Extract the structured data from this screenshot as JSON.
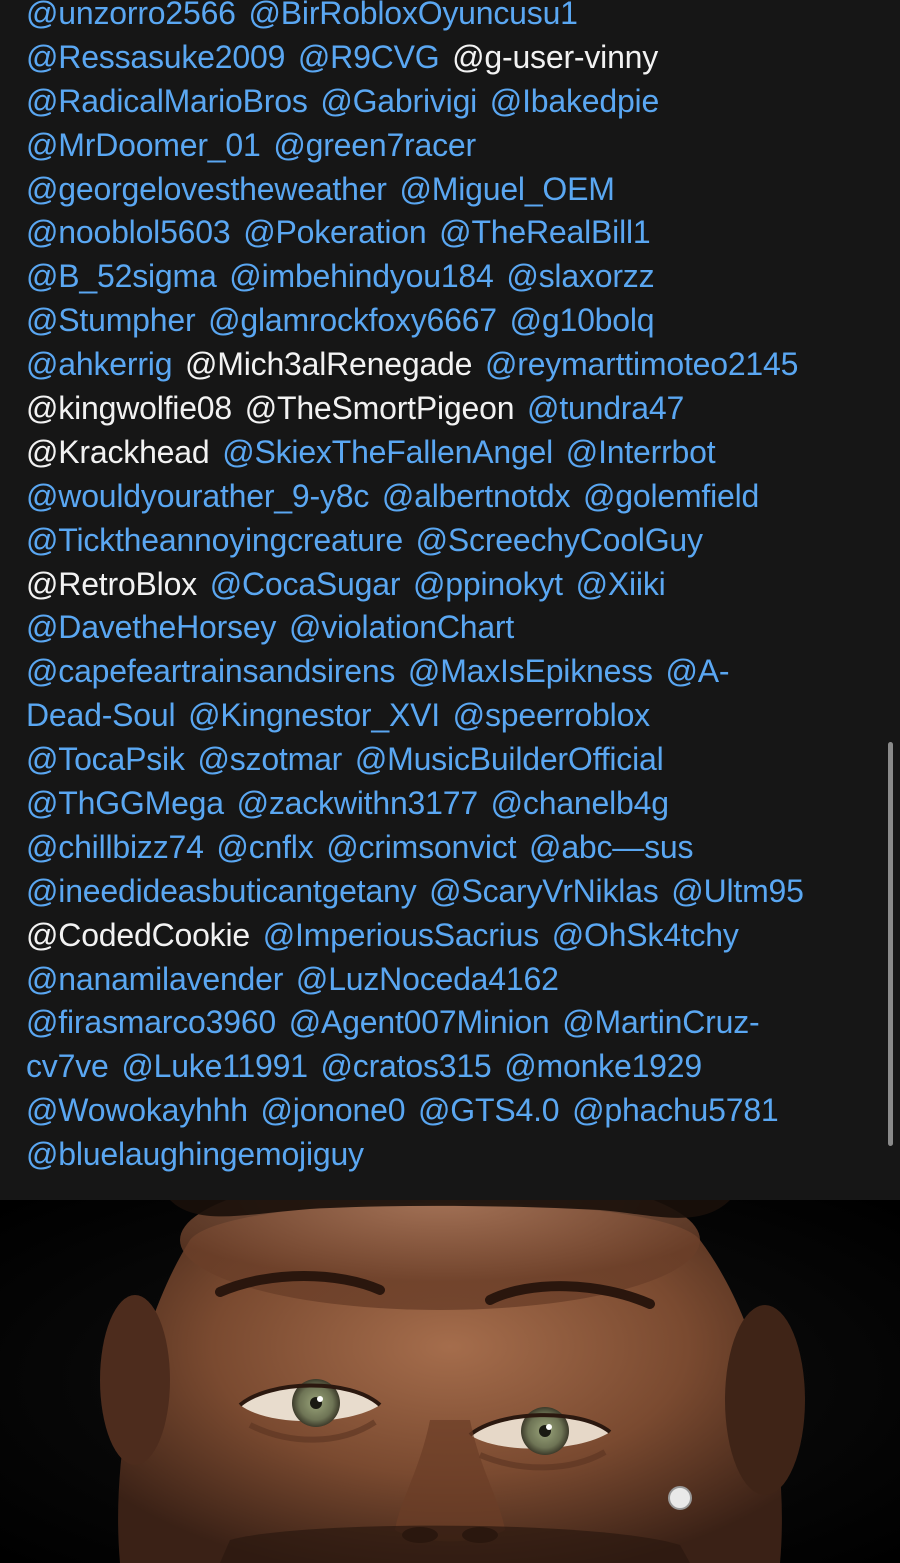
{
  "lines": [
    [
      {
        "t": "@unzorro2566",
        "m": true
      },
      {
        "t": "@BirRobloxOyuncusu1",
        "m": true
      }
    ],
    [
      {
        "t": "@Ressasuke2009",
        "m": true
      },
      {
        "t": "@R9CVG",
        "m": true
      },
      {
        "t": "@g-user-vinny",
        "m": false
      }
    ],
    [
      {
        "t": "@RadicalMarioBros",
        "m": true
      },
      {
        "t": "@Gabrivigi",
        "m": true
      },
      {
        "t": "@Ibakedpie",
        "m": true
      }
    ],
    [
      {
        "t": "@MrDoomer_01",
        "m": true
      },
      {
        "t": "@green7racer",
        "m": true
      }
    ],
    [
      {
        "t": "@georgelovestheweather",
        "m": true
      },
      {
        "t": "@Miguel_OEM",
        "m": true
      }
    ],
    [
      {
        "t": "@nooblol5603",
        "m": true
      },
      {
        "t": "@Pokeration",
        "m": true
      },
      {
        "t": "@TheRealBill1",
        "m": true
      }
    ],
    [
      {
        "t": "@B_52sigma",
        "m": true
      },
      {
        "t": "@imbehindyou184",
        "m": true
      },
      {
        "t": "@slaxorzz",
        "m": true
      }
    ],
    [
      {
        "t": "@Stumpher",
        "m": true
      },
      {
        "t": "@glamrockfoxy6667",
        "m": true
      },
      {
        "t": "@g10bolq",
        "m": true
      }
    ],
    [
      {
        "t": "@ahkerrig",
        "m": true
      },
      {
        "t": "@Mich3alRenegade",
        "m": false
      },
      {
        "t": "@reymarttimoteo2145",
        "m": true
      }
    ],
    [
      {
        "t": "@kingwolfie08",
        "m": false
      },
      {
        "t": "@TheSmortPigeon",
        "m": false
      },
      {
        "t": "@tundra47",
        "m": true
      }
    ],
    [
      {
        "t": "@Krackhead",
        "m": false
      },
      {
        "t": "@SkiexTheFallenAngel",
        "m": true
      },
      {
        "t": "@Interrbot",
        "m": true
      }
    ],
    [
      {
        "t": "@wouldyourather_9-y8c",
        "m": true
      },
      {
        "t": "@albertnotdx",
        "m": true
      },
      {
        "t": "@golemfield",
        "m": true
      }
    ],
    [
      {
        "t": "@Ticktheannoyingcreature",
        "m": true
      },
      {
        "t": "@ScreechyCoolGuy",
        "m": true
      }
    ],
    [
      {
        "t": "@RetroBlox",
        "m": false
      },
      {
        "t": "@CocaSugar",
        "m": true
      },
      {
        "t": "@ppinokyt",
        "m": true
      },
      {
        "t": "@Xiiki",
        "m": true
      }
    ],
    [
      {
        "t": "@DavetheHorsey",
        "m": true
      },
      {
        "t": "@violationChart",
        "m": true
      }
    ],
    [
      {
        "t": "@capefeartrainsandsirens",
        "m": true
      },
      {
        "t": "@MaxIsEpikness",
        "m": true
      },
      {
        "t": "@A-",
        "m": true
      }
    ],
    [
      {
        "t": "Dead-Soul",
        "m": true
      },
      {
        "t": "@Kingnestor_XVI",
        "m": true
      },
      {
        "t": "@speerroblox",
        "m": true
      }
    ],
    [
      {
        "t": "@TocaPsik",
        "m": true
      },
      {
        "t": "@szotmar",
        "m": true
      },
      {
        "t": "@MusicBuilderOfficial",
        "m": true
      }
    ],
    [
      {
        "t": "@ThGGMega",
        "m": true
      },
      {
        "t": "@zackwithn3177",
        "m": true
      },
      {
        "t": "@chanelb4g",
        "m": true
      }
    ],
    [
      {
        "t": "@chillbizz74",
        "m": true
      },
      {
        "t": "@cnflx",
        "m": true
      },
      {
        "t": "@crimsonvict",
        "m": true
      },
      {
        "t": "@abc—sus",
        "m": true
      }
    ],
    [
      {
        "t": "@ineedideasbuticantgetany",
        "m": true
      },
      {
        "t": "@ScaryVrNiklas",
        "m": true
      },
      {
        "t": "@Ultm95",
        "m": true
      }
    ],
    [
      {
        "t": "@CodedCookie",
        "m": false
      },
      {
        "t": "@ImperiousSacrius",
        "m": true
      },
      {
        "t": "@OhSk4tchy",
        "m": true
      }
    ],
    [
      {
        "t": "@nanamilavender",
        "m": true
      },
      {
        "t": "@LuzNoceda4162",
        "m": true
      }
    ],
    [
      {
        "t": "@firasmarco3960",
        "m": true
      },
      {
        "t": "@Agent007Minion",
        "m": true
      },
      {
        "t": "@MartinCruz-",
        "m": true
      }
    ],
    [
      {
        "t": "cv7ve",
        "m": true
      },
      {
        "t": "@Luke11991",
        "m": true
      },
      {
        "t": "@cratos315",
        "m": true
      },
      {
        "t": "@monke1929",
        "m": true
      }
    ],
    [
      {
        "t": "@Wowokayhhh",
        "m": true
      },
      {
        "t": "@jonone0",
        "m": true
      },
      {
        "t": "@GTS4.0",
        "m": true
      },
      {
        "t": "@phachu5781",
        "m": true
      }
    ],
    [
      {
        "t": "@bluelaughingemojiguy",
        "m": true
      }
    ]
  ],
  "colors": {
    "mention": "#5aa7f2",
    "plain": "#f2f2f2",
    "panel_bg": "#161616",
    "scrollbar": "#8a8a8a"
  },
  "photo": {
    "subject": "face-closeup"
  }
}
